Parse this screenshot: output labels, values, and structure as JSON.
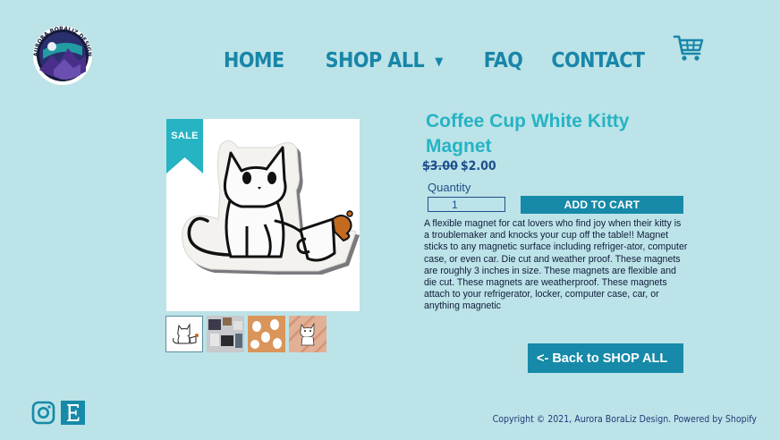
{
  "brand": {
    "logo_text": "AURORA BORALIZ DESIGN"
  },
  "nav": {
    "home": "HOME",
    "shop_all": "SHOP ALL",
    "faq": "FAQ",
    "contact": "CONTACT"
  },
  "product": {
    "badge": "SALE",
    "title": "Coffee Cup White Kitty Magnet",
    "price_old": "$3.00",
    "price_new": "$2.00",
    "quantity_label": "Quantity",
    "quantity_value": "1",
    "add_to_cart": "ADD TO CART",
    "description": "A flexible magnet for cat lovers who find joy when their kitty is a troublemaker and knocks your cup off the table!! Magnet sticks to any magnetic surface including refriger-ator, computer case, or even car. Die cut and weather proof. These magnets are roughly 3 inches in size. These magnets are flexible and die cut. These magnets are weatherproof. These magnets attach to your refrigerator, locker, computer case, car, or anything magnetic"
  },
  "back_button": "<-  Back to SHOP ALL",
  "footer": {
    "copyright": "Copyright © 2021, Aurora BoraLiz Design. Powered by Shopify"
  },
  "colors": {
    "background": "#bce3e8",
    "accent": "#168aa8",
    "title": "#26b3c4",
    "sale_ribbon": "#26b3c4"
  },
  "icons": {
    "cart": "shopping-cart-icon",
    "caret": "chevron-down-icon",
    "instagram": "instagram-icon",
    "etsy": "etsy-icon"
  }
}
